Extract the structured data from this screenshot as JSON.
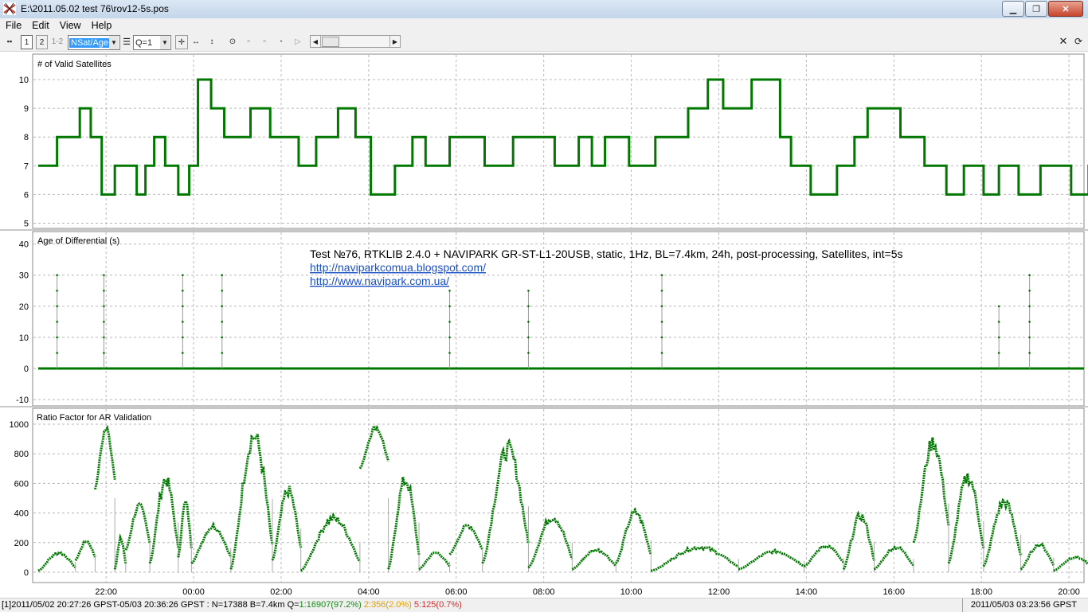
{
  "window": {
    "title": "E:\\2011.05.02 test 76\\rov12-5s.pos"
  },
  "menu": {
    "items": [
      "File",
      "Edit",
      "View",
      "Help"
    ]
  },
  "toolbar": {
    "frame_labels": [
      "1",
      "2",
      "1-2"
    ],
    "plot_type_value": "NSat/Age",
    "quality_value": "Q=1"
  },
  "annotation": {
    "text": "Test №76, RTKLIB 2.4.0 + NAVIPARK GR-ST-L1-20USB, static, 1Hz, BL=7.4km, 24h, post-processing, Satellites, int=5s",
    "link1": "http://naviparkcomua.blogspot.com/",
    "link2": "http://www.navipark.com.ua/"
  },
  "colors": {
    "series": "#007800",
    "link": "#1a4fc6",
    "grid": "#b8b8b8"
  },
  "chart_data": [
    {
      "type": "line",
      "title": "# of Valid Satellites",
      "ylim": [
        5,
        10
      ],
      "yticks": [
        5,
        6,
        7,
        8,
        9,
        10
      ],
      "grid": true,
      "series": [
        {
          "values_x_hours_from_start": [
            0,
            0.43,
            0.95,
            1.2,
            1.45,
            1.75,
            2.25,
            2.45,
            2.65,
            2.9,
            3.2,
            3.45,
            3.65,
            3.95,
            4.25,
            4.85,
            5.3,
            5.95,
            6.35,
            6.85,
            7.25,
            7.6,
            8.15,
            8.55,
            8.85,
            9.4,
            10.2,
            10.85,
            11.8,
            12.35,
            12.65,
            12.95,
            13.5,
            14.1,
            14.85,
            15.3,
            15.65,
            16.3,
            16.95,
            17.2,
            17.65,
            18.25,
            18.65,
            18.95,
            19.7,
            20.25,
            20.75,
            21.15,
            21.6,
            21.95,
            22.4,
            22.9,
            23.6,
            24.0,
            24.6,
            25.35,
            26.05,
            26.45,
            26.8,
            27.55,
            27.9,
            28.15,
            28.55,
            29.0,
            29.7,
            30.0,
            30.5,
            31.25,
            31.9,
            32.5,
            33.0,
            33.4,
            33.95,
            34.25,
            34.65,
            35.15,
            35.6,
            36.2,
            36.95,
            37.3,
            37.6,
            37.9,
            38.4
          ],
          "values": [
            7,
            8,
            9,
            8,
            6,
            7,
            6,
            7,
            8,
            7,
            6,
            7,
            10,
            9,
            8,
            9,
            8,
            7,
            8,
            9,
            8,
            6,
            7,
            8,
            7,
            8,
            7,
            8,
            7,
            8,
            7,
            8,
            7,
            8,
            9,
            10,
            9,
            10,
            8,
            7,
            6,
            7,
            8,
            9,
            8,
            7,
            6,
            7,
            6,
            7,
            6,
            7,
            6,
            7,
            6,
            7,
            6,
            7,
            8,
            7,
            8,
            7,
            8,
            7,
            6,
            7,
            6,
            7,
            8,
            7,
            6,
            7,
            6,
            7,
            6,
            7,
            8,
            7,
            8,
            7,
            8,
            7,
            7
          ]
        }
      ]
    },
    {
      "type": "scatter",
      "title": "Age of Differential (s)",
      "ylim": [
        -10,
        40
      ],
      "yticks": [
        -10,
        0,
        10,
        20,
        30,
        40
      ],
      "grid": true,
      "spikes": [
        {
          "x_hour_from_start": 0.43,
          "peak": 30
        },
        {
          "x_hour_from_start": 1.5,
          "peak": 30
        },
        {
          "x_hour_from_start": 3.3,
          "peak": 30
        },
        {
          "x_hour_from_start": 4.2,
          "peak": 30
        },
        {
          "x_hour_from_start": 9.4,
          "peak": 25
        },
        {
          "x_hour_from_start": 11.2,
          "peak": 25
        },
        {
          "x_hour_from_start": 14.25,
          "peak": 30
        },
        {
          "x_hour_from_start": 21.95,
          "peak": 20
        },
        {
          "x_hour_from_start": 22.65,
          "peak": 30
        }
      ],
      "baseline": 0
    },
    {
      "type": "scatter",
      "title": "Ratio Factor for AR Validation",
      "ylim": [
        0,
        1000
      ],
      "yticks": [
        0,
        200,
        400,
        600,
        800,
        1000
      ],
      "grid": true,
      "segments": [
        {
          "x0": 0.0,
          "x1": 0.85,
          "y0": 10,
          "y1": 140
        },
        {
          "x0": 0.85,
          "x1": 1.3,
          "y0": 80,
          "y1": 220
        },
        {
          "x0": 1.3,
          "x1": 1.75,
          "y0": 560,
          "y1": 1000
        },
        {
          "x0": 1.75,
          "x1": 2.0,
          "y0": 20,
          "y1": 240
        },
        {
          "x0": 2.0,
          "x1": 2.55,
          "y0": 150,
          "y1": 470
        },
        {
          "x0": 2.55,
          "x1": 3.2,
          "y0": 60,
          "y1": 670
        },
        {
          "x0": 3.2,
          "x1": 3.5,
          "y0": 100,
          "y1": 500
        },
        {
          "x0": 3.5,
          "x1": 4.4,
          "y0": 60,
          "y1": 330
        },
        {
          "x0": 4.4,
          "x1": 5.35,
          "y0": 20,
          "y1": 990
        },
        {
          "x0": 5.35,
          "x1": 6.0,
          "y0": 80,
          "y1": 590
        },
        {
          "x0": 6.0,
          "x1": 7.35,
          "y0": 10,
          "y1": 390
        },
        {
          "x0": 7.35,
          "x1": 8.0,
          "y0": 700,
          "y1": 1000
        },
        {
          "x0": 8.0,
          "x1": 8.7,
          "y0": 20,
          "y1": 670
        },
        {
          "x0": 8.7,
          "x1": 9.4,
          "y0": 20,
          "y1": 140
        },
        {
          "x0": 9.4,
          "x1": 10.15,
          "y0": 120,
          "y1": 330
        },
        {
          "x0": 10.15,
          "x1": 11.2,
          "y0": 60,
          "y1": 890
        },
        {
          "x0": 11.2,
          "x1": 12.2,
          "y0": 30,
          "y1": 400
        },
        {
          "x0": 12.2,
          "x1": 13.2,
          "y0": 20,
          "y1": 160
        },
        {
          "x0": 13.2,
          "x1": 14.0,
          "y0": 60,
          "y1": 430
        },
        {
          "x0": 14.0,
          "x1": 16.0,
          "y0": 10,
          "y1": 180
        },
        {
          "x0": 16.0,
          "x1": 17.5,
          "y0": 20,
          "y1": 150
        },
        {
          "x0": 17.5,
          "x1": 18.4,
          "y0": 40,
          "y1": 190
        },
        {
          "x0": 18.4,
          "x1": 19.1,
          "y0": 20,
          "y1": 410
        },
        {
          "x0": 19.1,
          "x1": 20.0,
          "y0": 20,
          "y1": 180
        },
        {
          "x0": 20.0,
          "x1": 20.8,
          "y0": 200,
          "y1": 930
        },
        {
          "x0": 20.8,
          "x1": 21.6,
          "y0": 60,
          "y1": 690
        },
        {
          "x0": 21.6,
          "x1": 22.45,
          "y0": 40,
          "y1": 510
        },
        {
          "x0": 22.45,
          "x1": 23.2,
          "y0": 20,
          "y1": 200
        },
        {
          "x0": 23.2,
          "x1": 24.1,
          "y0": 10,
          "y1": 110
        }
      ]
    }
  ],
  "x_axis": {
    "ticks": [
      "22:00",
      "00:00",
      "02:00",
      "04:00",
      "06:00",
      "08:00",
      "10:00",
      "12:00",
      "14:00",
      "16:00",
      "18:00",
      "20:00"
    ]
  },
  "status": {
    "left_prefix": "[1]2011/05/02 20:27:26 GPST-05/03 20:36:26 GPST : N=17388 B=7.4km Q=",
    "q1": "1:16907(97.2%)",
    "q2": "2:356(2.0%)",
    "q5": "5:125(0.7%)",
    "right": "2011/05/03 03:23:56 GPST"
  }
}
